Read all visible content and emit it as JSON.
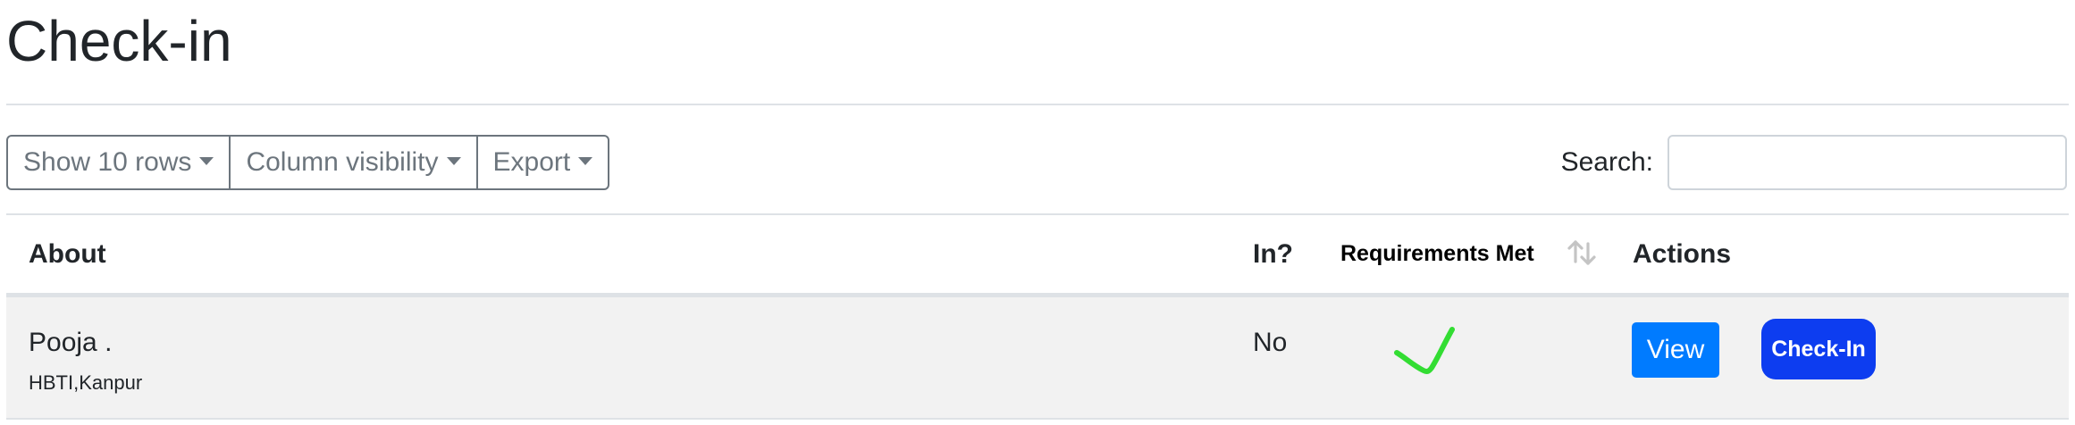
{
  "page": {
    "title": "Check-in"
  },
  "toolbar": {
    "show_rows_label": "Show 10 rows",
    "column_visibility_label": "Column visibility",
    "export_label": "Export"
  },
  "search": {
    "label": "Search:",
    "value": "",
    "placeholder": ""
  },
  "table": {
    "columns": [
      "About",
      "In?",
      "Requirements Met",
      "Actions"
    ],
    "rows": [
      {
        "name": "Pooja .",
        "organization": "HBTI,Kanpur",
        "in": "No",
        "requirements_met_icon": "checkmark-icon",
        "actions": [
          "View",
          "Check-In"
        ]
      }
    ]
  },
  "icons": {
    "sort": "sort-arrows-icon",
    "caret": "caret-down-icon",
    "check": "checkmark-icon"
  },
  "colors": {
    "primary_button": "#007bff",
    "checkin_button": "#0d3df0",
    "check_mark": "#33dd33",
    "row_bg": "#f2f2f2",
    "outline_button": "#6c757d"
  }
}
